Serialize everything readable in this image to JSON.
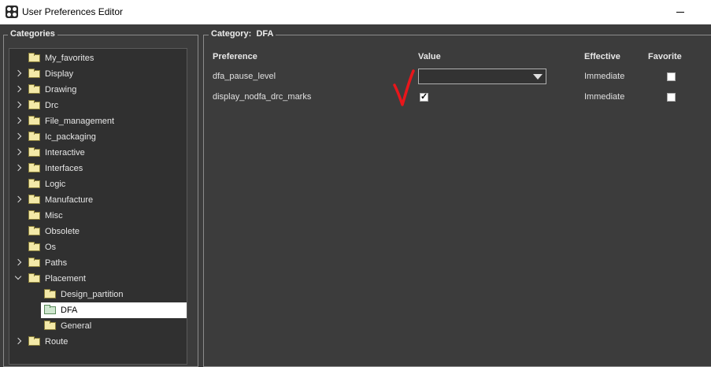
{
  "window": {
    "title": "User Preferences Editor"
  },
  "categories": {
    "title": "Categories",
    "tree": [
      {
        "label": "My_favorites",
        "level": 0,
        "expander": "none"
      },
      {
        "label": "Display",
        "level": 0,
        "expander": "collapsed"
      },
      {
        "label": "Drawing",
        "level": 0,
        "expander": "collapsed"
      },
      {
        "label": "Drc",
        "level": 0,
        "expander": "collapsed"
      },
      {
        "label": "File_management",
        "level": 0,
        "expander": "collapsed"
      },
      {
        "label": "Ic_packaging",
        "level": 0,
        "expander": "collapsed"
      },
      {
        "label": "Interactive",
        "level": 0,
        "expander": "collapsed"
      },
      {
        "label": "Interfaces",
        "level": 0,
        "expander": "collapsed"
      },
      {
        "label": "Logic",
        "level": 0,
        "expander": "none"
      },
      {
        "label": "Manufacture",
        "level": 0,
        "expander": "collapsed"
      },
      {
        "label": "Misc",
        "level": 0,
        "expander": "none"
      },
      {
        "label": "Obsolete",
        "level": 0,
        "expander": "none"
      },
      {
        "label": "Os",
        "level": 0,
        "expander": "none"
      },
      {
        "label": "Paths",
        "level": 0,
        "expander": "collapsed"
      },
      {
        "label": "Placement",
        "level": 0,
        "expander": "expanded"
      },
      {
        "label": "Design_partition",
        "level": 1,
        "expander": "none"
      },
      {
        "label": "DFA",
        "level": 1,
        "expander": "none",
        "selected": true
      },
      {
        "label": "General",
        "level": 1,
        "expander": "none"
      },
      {
        "label": "Route",
        "level": 0,
        "expander": "collapsed"
      }
    ]
  },
  "category_panel": {
    "title": "Category:  DFA",
    "headers": {
      "preference": "Preference",
      "value": "Value",
      "effective": "Effective",
      "favorite": "Favorite"
    },
    "rows": [
      {
        "preference": "dfa_pause_level",
        "value_type": "dropdown",
        "value": "",
        "effective": "Immediate",
        "favorite": false
      },
      {
        "preference": "display_nodfa_drc_marks",
        "value_type": "checkbox",
        "value": true,
        "effective": "Immediate",
        "favorite": false
      }
    ]
  },
  "annotation": {
    "color": "#e8161b"
  }
}
